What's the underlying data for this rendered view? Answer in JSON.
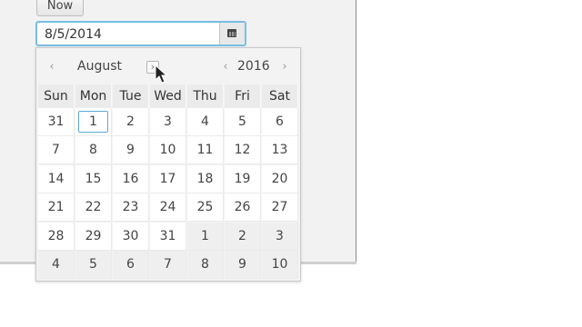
{
  "toolbar": {
    "now_label": "Now"
  },
  "date_field": {
    "value": "8/5/2014"
  },
  "calendar": {
    "month": "August",
    "year": "2016",
    "prev_month": "‹",
    "next_month": "›",
    "prev_year": "‹",
    "next_year": "›",
    "weekdays": [
      "Sun",
      "Mon",
      "Tue",
      "Wed",
      "Thu",
      "Fri",
      "Sat"
    ],
    "weeks": [
      [
        "31",
        "1",
        "2",
        "3",
        "4",
        "5",
        "6"
      ],
      [
        "7",
        "8",
        "9",
        "10",
        "11",
        "12",
        "13"
      ],
      [
        "14",
        "15",
        "16",
        "17",
        "18",
        "19",
        "20"
      ],
      [
        "21",
        "22",
        "23",
        "24",
        "25",
        "26",
        "27"
      ],
      [
        "28",
        "29",
        "30",
        "31",
        "1",
        "2",
        "3"
      ],
      [
        "4",
        "5",
        "6",
        "7",
        "8",
        "9",
        "10"
      ]
    ],
    "selected_day": "1",
    "selected_week_index": 0,
    "selected_day_index": 1,
    "other_month_cells": [
      [
        4,
        4
      ],
      [
        4,
        5
      ],
      [
        4,
        6
      ],
      [
        5,
        0
      ],
      [
        5,
        1
      ],
      [
        5,
        2
      ],
      [
        5,
        3
      ],
      [
        5,
        4
      ],
      [
        5,
        5
      ],
      [
        5,
        6
      ]
    ]
  }
}
